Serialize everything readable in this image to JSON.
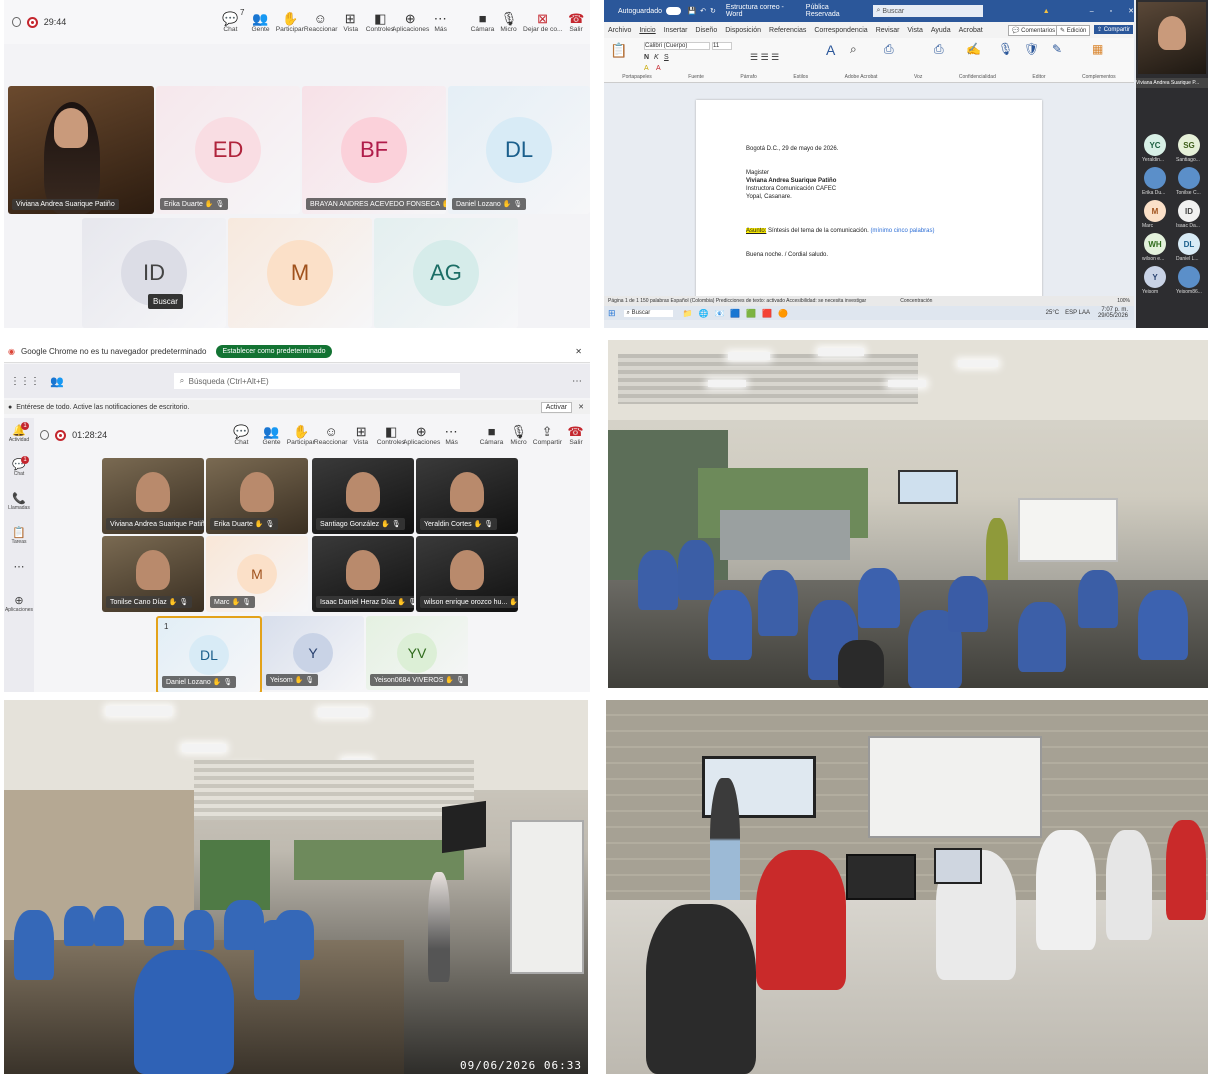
{
  "panel1": {
    "timer": "29:44",
    "toolbar": [
      {
        "icon": "chat-icon",
        "glyph": "💬",
        "label": "Chat"
      },
      {
        "icon": "people-icon",
        "glyph": "👥",
        "label": "Gente"
      },
      {
        "icon": "raise-hand-icon",
        "glyph": "✋",
        "label": "Participar"
      },
      {
        "icon": "react-icon",
        "glyph": "☺",
        "label": "Reaccionar"
      },
      {
        "icon": "view-icon",
        "glyph": "⊞",
        "label": "Vista"
      },
      {
        "icon": "controls-icon",
        "glyph": "◧",
        "label": "Controles"
      },
      {
        "icon": "apps-icon",
        "glyph": "⊕",
        "label": "Aplicaciones"
      },
      {
        "icon": "more-icon",
        "glyph": "⋯",
        "label": "Más"
      }
    ],
    "people_count": "7",
    "camera_label": "Cámara",
    "mic_label": "Micro",
    "share_label": "Dejar de co...",
    "leave_label": "Salir",
    "participants": [
      {
        "name": "Viviana Andrea Suarique Patiño",
        "initials": "",
        "video": true
      },
      {
        "name": "Erika Duarte",
        "initials": "ED",
        "bg": "#f9dde3",
        "fg": "#b0243c"
      },
      {
        "name": "BRAYAN ANDRES ACEVEDO FONSECA",
        "initials": "BF",
        "bg": "#fbd1da",
        "fg": "#b01c4a"
      },
      {
        "name": "Daniel Lozano",
        "initials": "DL",
        "bg": "#d8ebf6",
        "fg": "#1b5f8c"
      },
      {
        "name": "",
        "initials": "ID",
        "bg": "#dcdde6",
        "fg": "#444"
      },
      {
        "name": "",
        "initials": "M",
        "bg": "#fbe0c8",
        "fg": "#a0521d"
      },
      {
        "name": "",
        "initials": "AG",
        "bg": "#d6ecea",
        "fg": "#1c6e66"
      }
    ],
    "tooltip": "Buscar"
  },
  "panel2": {
    "title": "Estructura correo - Word",
    "autosave": "Autoguardado",
    "sensitivity": "Pública Reservada",
    "search": "Buscar",
    "menu": [
      "Archivo",
      "Inicio",
      "Insertar",
      "Diseño",
      "Disposición",
      "Referencias",
      "Correspondencia",
      "Revisar",
      "Vista",
      "Ayuda",
      "Acrobat"
    ],
    "comments_btn": "Comentarios",
    "edit_btn": "Edición",
    "share_btn": "Compartir",
    "font_name": "Calibri (Cuerpo)",
    "font_size": "11",
    "ribbon_groups": [
      "Portapapeles",
      "Fuente",
      "Párrafo",
      "Estilos",
      "Adobe Acrobat",
      "Voz",
      "Confidencialidad",
      "Editor",
      "Complementos"
    ],
    "doc": {
      "date": "Bogotá D.C., 29 de mayo de 2026.",
      "title": "Magister",
      "name": "Viviana Andrea Suarique Patiño",
      "role": "Instructora Comunicación CAFEC",
      "city": "Yopal, Casanare.",
      "subject_label": "Asunto:",
      "subject": "Síntesis del tema de la comunicación.",
      "subject_hint": "(mínimo cinco palabras)",
      "greeting": "Buena noche. / Cordial saludo."
    },
    "status": "Página 1 de 1   150 palabras   Español (Colombia)   Predicciones de texto: activado   Accesibilidad: se necesita investigar",
    "focus": "Concentración",
    "zoom": "100%",
    "taskbar_search": "Buscar",
    "clock_time": "7:07 p. m.",
    "clock_date": "29/05/2026",
    "weather": "25°C",
    "lang": "ESP LAA",
    "presenter": "Viviana Andrea Suarique P...",
    "side": [
      {
        "initials": "YC",
        "label": "Yeraldin...",
        "bg": "#d8f0e6",
        "fg": "#1a5e3e"
      },
      {
        "initials": "SG",
        "label": "Santiago...",
        "bg": "#e6f0d8",
        "fg": "#3e5e1a"
      },
      {
        "initials": "",
        "label": "Erika Du...",
        "bg": "#5b8fc9",
        "fg": "#fff"
      },
      {
        "initials": "",
        "label": "Tonilse C...",
        "bg": "#5b8fc9",
        "fg": "#fff"
      },
      {
        "initials": "M",
        "label": "Marc",
        "bg": "#fbe0c8",
        "fg": "#a0521d"
      },
      {
        "initials": "ID",
        "label": "Isaac Da...",
        "bg": "#f1f1f1",
        "fg": "#444"
      },
      {
        "initials": "WH",
        "label": "wilson e...",
        "bg": "#e3f1dc",
        "fg": "#2f6b1c"
      },
      {
        "initials": "DL",
        "label": "Daniel L...",
        "bg": "#d8ebf6",
        "fg": "#1b5f8c"
      },
      {
        "initials": "Y",
        "label": "Yeisom",
        "bg": "#c9d3e6",
        "fg": "#28406e"
      },
      {
        "initials": "",
        "label": "Yeisom86...",
        "bg": "#5b8fc9",
        "fg": "#fff"
      }
    ]
  },
  "panel3": {
    "chrome_banner": "Google Chrome no es tu navegador predeterminado",
    "chrome_default_btn": "Establecer como predeterminado",
    "search_placeholder": "Búsqueda (Ctrl+Alt+E)",
    "notif_text": "Entérese de todo. Active las notificaciones de escritorio.",
    "notif_btn": "Activar",
    "timer": "01:28:24",
    "rail": [
      {
        "icon": "activity-icon",
        "glyph": "🔔",
        "label": "Actividad",
        "badge": "1"
      },
      {
        "icon": "chat-icon",
        "glyph": "💬",
        "label": "Chat",
        "badge": "1"
      },
      {
        "icon": "calls-icon",
        "glyph": "📞",
        "label": "Llamadas",
        "badge": ""
      },
      {
        "icon": "tasks-icon",
        "glyph": "📋",
        "label": "Tareas",
        "badge": ""
      },
      {
        "icon": "more-icon",
        "glyph": "⋯",
        "label": "",
        "badge": ""
      },
      {
        "icon": "apps-icon",
        "glyph": "⊕",
        "label": "Aplicaciones",
        "badge": ""
      }
    ],
    "toolbar": [
      {
        "icon": "chat-icon",
        "glyph": "💬",
        "label": "Chat"
      },
      {
        "icon": "people-icon",
        "glyph": "👥",
        "label": "Gente"
      },
      {
        "icon": "raise-hand-icon",
        "glyph": "✋",
        "label": "Participar"
      },
      {
        "icon": "react-icon",
        "glyph": "☺",
        "label": "Reaccionar"
      },
      {
        "icon": "view-icon",
        "glyph": "⊞",
        "label": "Vista"
      },
      {
        "icon": "controls-icon",
        "glyph": "◧",
        "label": "Controles"
      },
      {
        "icon": "apps-icon",
        "glyph": "⊕",
        "label": "Aplicaciones"
      },
      {
        "icon": "more-icon",
        "glyph": "⋯",
        "label": "Más"
      }
    ],
    "camera_label": "Cámara",
    "mic_label": "Micro",
    "share_label": "Compartir",
    "leave_label": "Salir",
    "participants": [
      {
        "name": "Viviana Andrea Suarique Patiño",
        "video": "room"
      },
      {
        "name": "Erika Duarte",
        "video": "room"
      },
      {
        "name": "Santiago González",
        "video": "dark"
      },
      {
        "name": "Yeraldin Cortes",
        "video": "dark"
      },
      {
        "name": "Tonilse Cano Díaz",
        "video": "room"
      },
      {
        "name": "Marc",
        "initials": "M",
        "bg": "#fbe0c8",
        "fg": "#a0521d"
      },
      {
        "name": "Isaac Daniel Heraz Díaz",
        "video": "dark"
      },
      {
        "name": "wilson enrique orozco hu...",
        "video": "dark"
      },
      {
        "name": "Daniel Lozano",
        "initials": "DL",
        "bg": "#d8ebf6",
        "fg": "#1b5f8c",
        "hand": "1"
      },
      {
        "name": "Yeisom",
        "initials": "Y",
        "bg": "#c9d3e6",
        "fg": "#28406e"
      },
      {
        "name": "Yeison0684 VIVEROS",
        "initials": "YV",
        "bg": "#dcefd6",
        "fg": "#2f6b1c"
      }
    ]
  },
  "panel5": {
    "timestamp": "09/06/2026 06:33"
  }
}
